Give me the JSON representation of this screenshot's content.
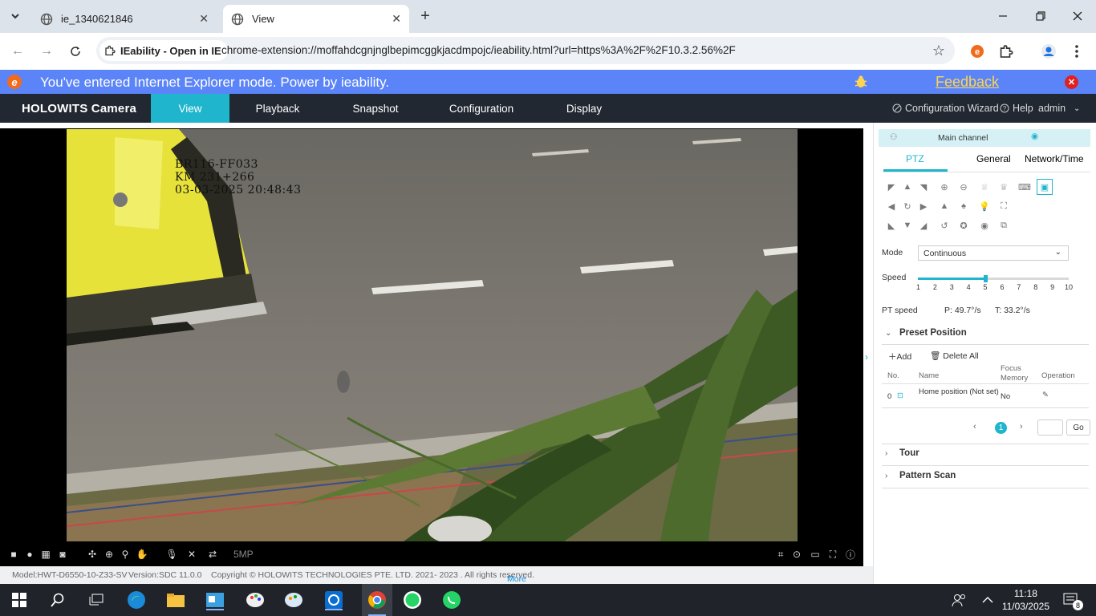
{
  "browser": {
    "tabs": [
      {
        "title": "ie_1340621846"
      },
      {
        "title": "View"
      }
    ],
    "ie_chip": "IEability - Open in IE",
    "url": "chrome-extension://moffahdcgnjnglbepimcggkjacdmpojc/ieability.html?url=https%3A%2F%2F10.3.2.56%2F"
  },
  "banner": {
    "message": "You've entered Internet Explorer mode. Power by ieability.",
    "feedback": "Feedback"
  },
  "appnav": {
    "brand": "HOLOWITS Camera",
    "items": [
      "View",
      "Playback",
      "Snapshot",
      "Configuration",
      "Display"
    ],
    "active": "View",
    "wizard": "Configuration Wizard",
    "help": "Help",
    "user": "admin"
  },
  "video": {
    "osd_lines": [
      "BR116-FF033",
      "KM 231+266",
      "03-03-2025 20:48:43"
    ],
    "resolution": "5MP"
  },
  "footer": {
    "model": "Model:HWT-D6550-10-Z33-SV",
    "version": "Version:SDC 11.0.0",
    "copyright": "Copyright © HOLOWITS TECHNOLOGIES PTE. LTD. 2021- 2023 . All rights reserved.",
    "more": "More"
  },
  "panel": {
    "channel": "Main channel",
    "tabs": [
      "PTZ",
      "General",
      "Network/Time"
    ],
    "active_tab": "PTZ",
    "mode_label": "Mode",
    "mode_value": "Continuous",
    "speed_label": "Speed",
    "speed_ticks": [
      "1",
      "2",
      "3",
      "4",
      "5",
      "6",
      "7",
      "8",
      "9",
      "10"
    ],
    "speed_value": 5,
    "pt_speed_label": "PT speed",
    "pt_p": "P: 49.7°/s",
    "pt_t": "T: 33.2°/s",
    "preset": {
      "title": "Preset Position",
      "add": "Add",
      "delete_all": "Delete All",
      "headers": {
        "no": "No.",
        "name": "Name",
        "focus": "Focus Memory",
        "operation": "Operation"
      },
      "rows": [
        {
          "no": "0",
          "name": "Home position (Not set)",
          "focus": "No"
        }
      ],
      "current_page": "1",
      "go": "Go"
    },
    "tour": "Tour",
    "pattern_scan": "Pattern Scan"
  },
  "taskbar": {
    "time": "11:18",
    "date": "11/03/2025",
    "notifications": "8"
  }
}
